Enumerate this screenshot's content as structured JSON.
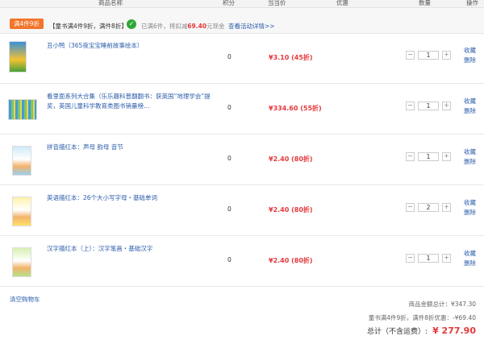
{
  "header": {
    "col_name": "商品名称",
    "col_points": "积分",
    "col_price": "当当价",
    "col_discount": "优惠",
    "col_qty": "数量",
    "col_action": "操作"
  },
  "promo": {
    "tag": "满4件9折",
    "text": "【童书满4件9折，满件8折】",
    "status_prefix": "已满6件，将扣减",
    "status_amount": "69.40",
    "status_suffix": "元现金",
    "link": "查看活动详情>>"
  },
  "items": [
    {
      "title": "丑小鸭（365夜宝宝睡前故事绘本）",
      "points": "0",
      "price": "¥3.10",
      "discount": "(45折)",
      "qty": "1",
      "fav": "收藏",
      "del": "删除"
    },
    {
      "title": "看里面系列大合集（乐乐趣科普翻翻书：获英国“地理学会”提奖，英国儿童科学教育类图书销量榜…",
      "points": "0",
      "price": "¥334.60",
      "discount": "(55折)",
      "qty": "1",
      "fav": "收藏",
      "del": "删除"
    },
    {
      "title": "拼音描红本：声母 韵母 音节",
      "points": "0",
      "price": "¥2.40",
      "discount": "(80折)",
      "qty": "1",
      "fav": "收藏",
      "del": "删除"
    },
    {
      "title": "英语描红本：26个大小写字母・基础单词",
      "points": "0",
      "price": "¥2.40",
      "discount": "(80折)",
      "qty": "2",
      "fav": "收藏",
      "del": "删除"
    },
    {
      "title": "汉字描红本（上）：汉字笔画・基础汉字",
      "points": "0",
      "price": "¥2.40",
      "discount": "(80折)",
      "qty": "1",
      "fav": "收藏",
      "del": "删除"
    }
  ],
  "footer": {
    "clear": "清空购物车",
    "subtotal": "商品金额总计：¥347.30",
    "promo_discount": "童书满4件9折，满件8折优惠：-¥69.40",
    "total_label": "总计（不含运费）:",
    "total_value": "¥ 277.90"
  },
  "colors": {
    "accent": "#e4393c",
    "link": "#2a5caa",
    "tag": "#f2752b",
    "ok": "#2fa838"
  }
}
